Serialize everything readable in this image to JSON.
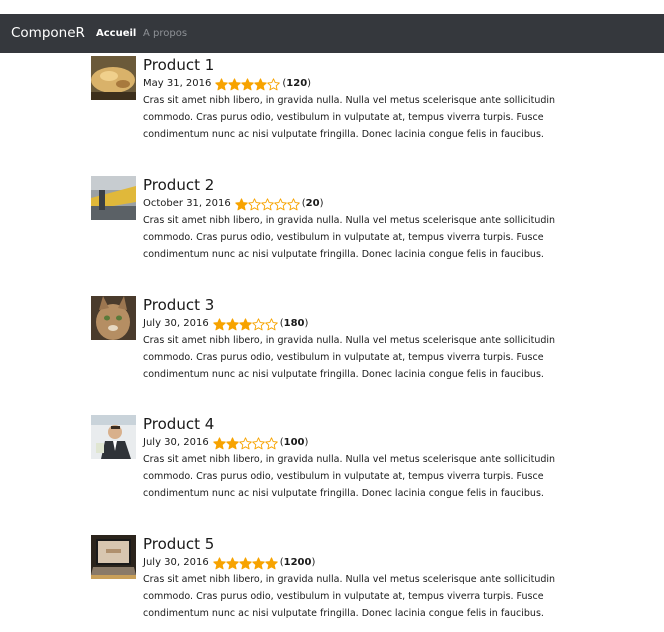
{
  "nav": {
    "brand": "ComponeR",
    "links": [
      {
        "label": "Accueil",
        "active": true
      },
      {
        "label": "A propos",
        "active": false
      }
    ]
  },
  "colors": {
    "navbar": "#35383d",
    "star_fill": "#f7a300",
    "star_outline": "#f7a300"
  },
  "products": [
    {
      "title": "Product 1",
      "date": "May 31, 2016",
      "rating": 4,
      "max_rating": 5,
      "count_text": "120",
      "thumbnail": "food-photo",
      "description": "Cras sit amet nibh libero, in gravida nulla. Nulla vel metus scelerisque ante sollicitudin commodo. Cras purus odio, vestibulum in vulputate at, tempus viverra turpis. Fusce condimentum nunc ac nisi vulputate fringilla. Donec lacinia congue felis in faucibus."
    },
    {
      "title": "Product 2",
      "date": "October 31, 2016",
      "rating": 1,
      "max_rating": 5,
      "count_text": "20",
      "thumbnail": "street-photo",
      "description": "Cras sit amet nibh libero, in gravida nulla. Nulla vel metus scelerisque ante sollicitudin commodo. Cras purus odio, vestibulum in vulputate at, tempus viverra turpis. Fusce condimentum nunc ac nisi vulputate fringilla. Donec lacinia congue felis in faucibus."
    },
    {
      "title": "Product 3",
      "date": "July 30, 2016",
      "rating": 3,
      "max_rating": 5,
      "count_text": "180",
      "thumbnail": "cat-photo",
      "description": "Cras sit amet nibh libero, in gravida nulla. Nulla vel metus scelerisque ante sollicitudin commodo. Cras purus odio, vestibulum in vulputate at, tempus viverra turpis. Fusce condimentum nunc ac nisi vulputate fringilla. Donec lacinia congue felis in faucibus."
    },
    {
      "title": "Product 4",
      "date": "July 30, 2016",
      "rating": 2,
      "max_rating": 5,
      "count_text": "100",
      "thumbnail": "businessman-photo",
      "description": "Cras sit amet nibh libero, in gravida nulla. Nulla vel metus scelerisque ante sollicitudin commodo. Cras purus odio, vestibulum in vulputate at, tempus viverra turpis. Fusce condimentum nunc ac nisi vulputate fringilla. Donec lacinia congue felis in faucibus."
    },
    {
      "title": "Product 5",
      "date": "July 30, 2016",
      "rating": 5,
      "max_rating": 5,
      "count_text": "1200",
      "thumbnail": "laptop-photo",
      "description": "Cras sit amet nibh libero, in gravida nulla. Nulla vel metus scelerisque ante sollicitudin commodo. Cras purus odio, vestibulum in vulputate at, tempus viverra turpis. Fusce condimentum nunc ac nisi vulputate fringilla. Donec lacinia congue felis in faucibus."
    }
  ]
}
